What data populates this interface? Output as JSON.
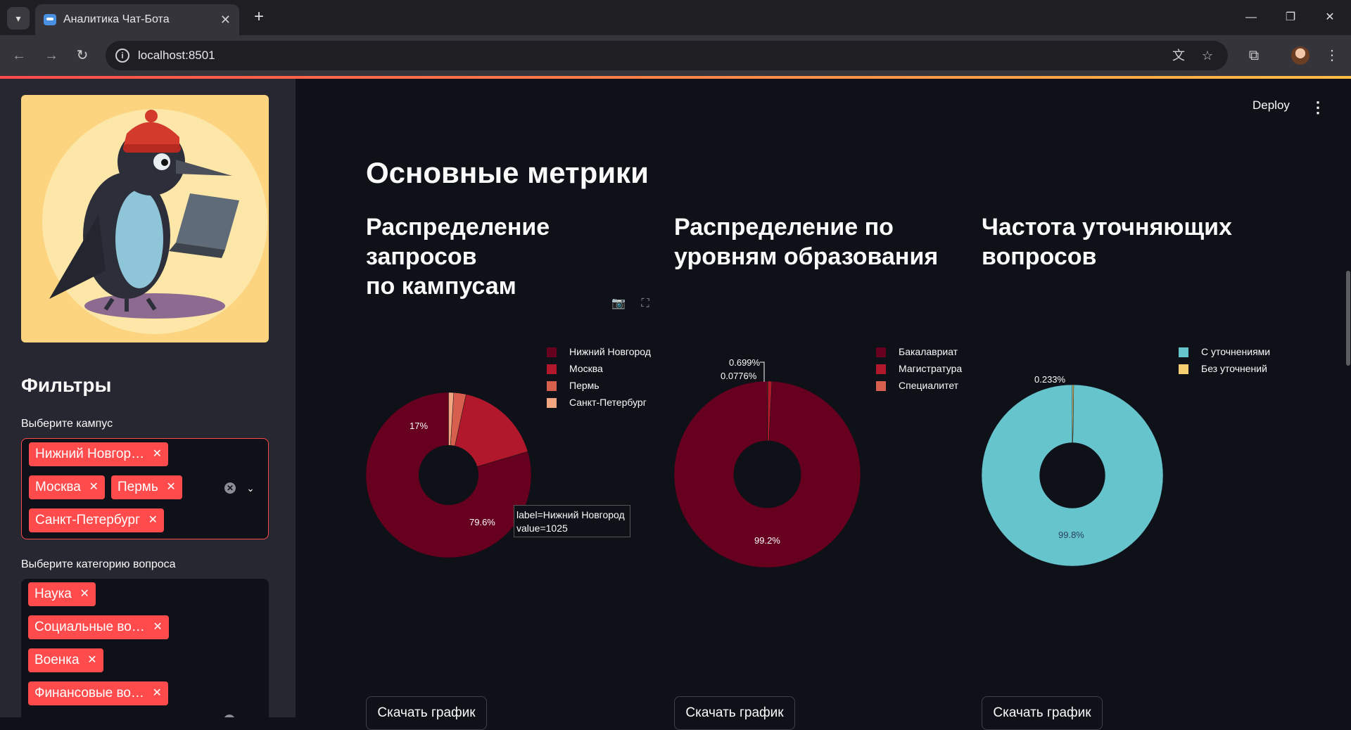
{
  "browser": {
    "tab_title": "Аналитика Чат-Бота",
    "url": "localhost:8501"
  },
  "app": {
    "deploy_label": "Deploy",
    "page_title": "Основные метрики",
    "accent_color": "#ff4b4b"
  },
  "sidebar": {
    "filters_title": "Фильтры",
    "campus_label": "Выберите кампус",
    "campus_selected": [
      "Нижний Новгор…",
      "Москва",
      "Пермь",
      "Санкт-Петербург"
    ],
    "category_label": "Выберите категорию вопроса",
    "category_selected": [
      "Наука",
      "Социальные во…",
      "Военка",
      "Финансовые во…"
    ]
  },
  "charts": {
    "campus_title_line1": "Распределение запросов",
    "campus_title_line2": "по кампусам",
    "edu_title_line1": "Распределение по",
    "edu_title_line2": "уровням образования",
    "clarify_title_line1": "Частота уточняющих",
    "clarify_title_line2": "вопросов",
    "download_label": "Скачать график",
    "tooltip_line1": "label=Нижний Новгород",
    "tooltip_line2": "value=1025"
  },
  "chart_data": [
    {
      "type": "pie",
      "hole": true,
      "labels": [
        "Нижний Новгород",
        "Москва",
        "Пермь",
        "Санкт-Петербург"
      ],
      "values": [
        79.6,
        17,
        2.4,
        1.0
      ],
      "value_labels": [
        "79.6%",
        "17%",
        "",
        ""
      ],
      "colors": [
        "#67001f",
        "#b2182b",
        "#d6604d",
        "#f4a582"
      ],
      "legend_position": "top-right"
    },
    {
      "type": "pie",
      "hole": true,
      "labels": [
        "Бакалавриат",
        "Магистратура",
        "Специалитет"
      ],
      "values": [
        99.2,
        0.699,
        0.0776
      ],
      "value_labels": [
        "99.2%",
        "0.699%",
        "0.0776%"
      ],
      "colors": [
        "#67001f",
        "#b2182b",
        "#d6604d"
      ],
      "legend_position": "top-right"
    },
    {
      "type": "pie",
      "hole": true,
      "labels": [
        "С уточнениями",
        "Без уточнений"
      ],
      "values": [
        99.8,
        0.233
      ],
      "value_labels": [
        "99.8%",
        "0.233%"
      ],
      "colors": [
        "#66c5cc",
        "#f6cf71"
      ],
      "legend_position": "top-right"
    }
  ]
}
